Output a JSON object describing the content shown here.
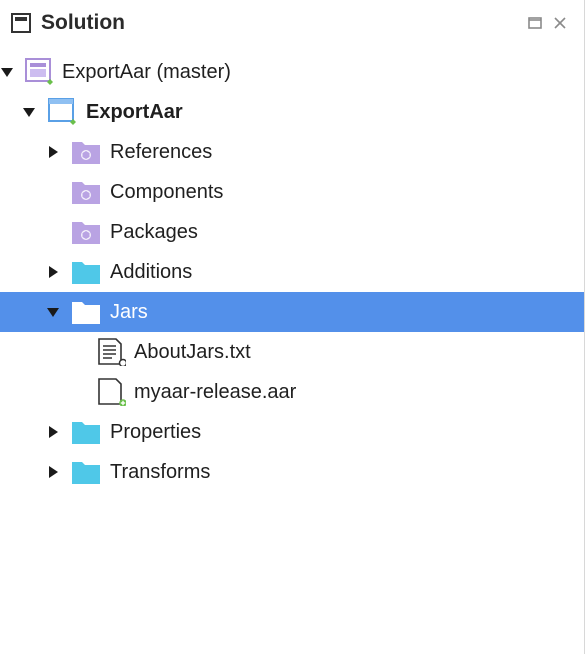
{
  "panel": {
    "title": "Solution",
    "header_icon": "solution-panel-icon",
    "buttons": [
      {
        "name": "maximize-icon"
      },
      {
        "name": "close-icon"
      }
    ]
  },
  "colors": {
    "selection": "#5390ea",
    "folder": "#4fc8e8",
    "project_purple": "#a98fd8",
    "project_blue": "#5aa0e6",
    "status_green": "#6abf4b"
  },
  "tree": [
    {
      "label": "ExportAar (master)",
      "icon": "solution-icon",
      "expanded": true,
      "depth": 0
    },
    {
      "label": "ExportAar",
      "icon": "project-icon",
      "expanded": true,
      "depth": 1,
      "bold": true
    },
    {
      "label": "References",
      "icon": "references-folder-icon",
      "expanded": false,
      "depth": 2
    },
    {
      "label": "Components",
      "icon": "components-folder-icon",
      "depth": 2
    },
    {
      "label": "Packages",
      "icon": "packages-folder-icon",
      "depth": 2
    },
    {
      "label": "Additions",
      "icon": "folder-icon",
      "expanded": false,
      "depth": 2
    },
    {
      "label": "Jars",
      "icon": "folder-icon",
      "expanded": true,
      "depth": 2,
      "selected": true
    },
    {
      "label": "AboutJars.txt",
      "icon": "text-file-icon",
      "depth": 3
    },
    {
      "label": "myaar-release.aar",
      "icon": "file-icon",
      "depth": 3
    },
    {
      "label": "Properties",
      "icon": "folder-icon",
      "expanded": false,
      "depth": 2
    },
    {
      "label": "Transforms",
      "icon": "folder-icon",
      "expanded": false,
      "depth": 2
    }
  ]
}
